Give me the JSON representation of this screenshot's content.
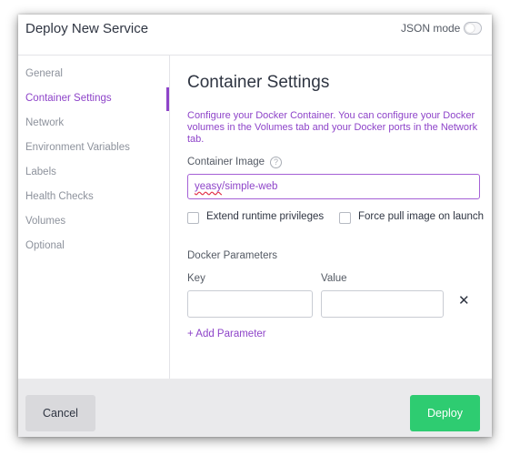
{
  "header": {
    "title": "Deploy New Service",
    "json_mode_label": "JSON mode",
    "json_mode_enabled": false
  },
  "sidebar": {
    "items": [
      {
        "label": "General"
      },
      {
        "label": "Container Settings",
        "active": true
      },
      {
        "label": "Network"
      },
      {
        "label": "Environment Variables"
      },
      {
        "label": "Labels"
      },
      {
        "label": "Health Checks"
      },
      {
        "label": "Volumes"
      },
      {
        "label": "Optional"
      }
    ]
  },
  "main": {
    "title": "Container Settings",
    "description": "Configure your Docker Container. You can configure your Docker volumes in the Volumes tab and your Docker ports in the Network tab.",
    "container_image": {
      "label": "Container Image",
      "help_icon": "question-circle-icon",
      "value_part1": "yeasy",
      "value_part2": "/simple-web"
    },
    "options": {
      "extend_runtime_label": "Extend runtime privileges",
      "extend_runtime_checked": false,
      "force_pull_label": "Force pull image on launch",
      "force_pull_checked": false
    },
    "docker_parameters": {
      "heading": "Docker Parameters",
      "key_label": "Key",
      "value_label": "Value",
      "rows": [
        {
          "key": "",
          "value": ""
        }
      ],
      "remove_icon": "close-icon",
      "remove_glyph": "✕",
      "add_label": "+ Add Parameter"
    }
  },
  "footer": {
    "cancel_label": "Cancel",
    "deploy_label": "Deploy"
  },
  "colors": {
    "accent": "#8e44c9",
    "deploy": "#2ecc71",
    "footer_bg": "#eaeaec"
  }
}
